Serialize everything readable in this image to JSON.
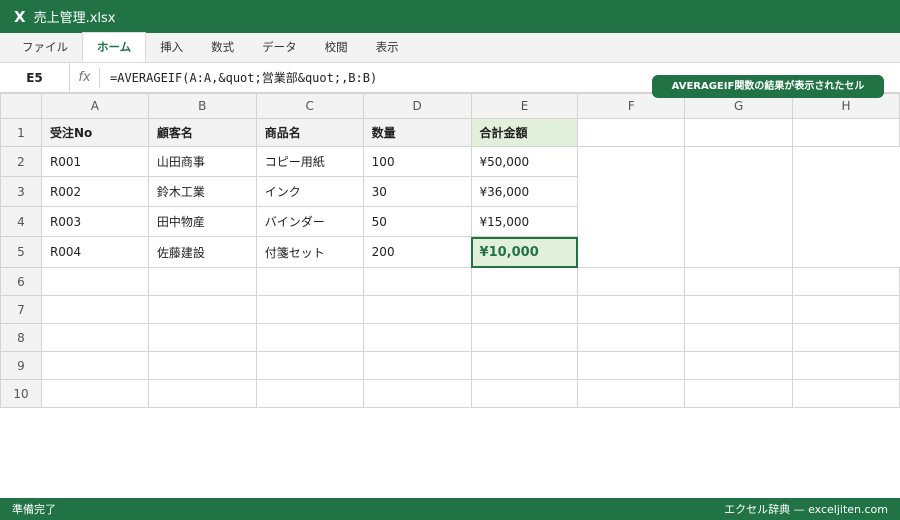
{
  "window": {
    "logo": "X",
    "title": "売上管理.xlsx"
  },
  "ribbon": {
    "tabs": [
      "ファイル",
      "ホーム",
      "挿入",
      "数式",
      "データ",
      "校閲",
      "表示"
    ],
    "active_index": 1
  },
  "formula_bar": {
    "cell_ref": "E5",
    "fx": "fx",
    "formula": "=AVERAGEIF(A:A,&quot;営業部&quot;,B:B)"
  },
  "callout": "AVERAGEIF関数の結果が表示されたセル",
  "sheet": {
    "columns": [
      "A",
      "B",
      "C",
      "D",
      "E",
      "F",
      "G",
      "H"
    ],
    "rows": [
      "1",
      "2",
      "3",
      "4",
      "5",
      "6",
      "7",
      "8",
      "9",
      "10"
    ],
    "header": [
      "受注No",
      "顧客名",
      "商品名",
      "数量",
      "合計金額"
    ],
    "data": [
      [
        "R001",
        "山田商事",
        "コピー用紙",
        "100",
        "¥50,000"
      ],
      [
        "R002",
        "鈴木工業",
        "インク",
        "30",
        "¥36,000"
      ],
      [
        "R003",
        "田中物産",
        "バインダー",
        "50",
        "¥15,000"
      ],
      [
        "R004",
        "佐藤建設",
        "付箋セット",
        "200",
        "¥10,000"
      ]
    ],
    "selected_cell": "E5"
  },
  "status": {
    "left": "準備完了",
    "right": "エクセル辞典 — exceljiten.com"
  },
  "colors": {
    "accent": "#217346",
    "highlight": "#e2efda",
    "header_bg": "#f3f3f3",
    "gridline": "#d4d4d4"
  }
}
